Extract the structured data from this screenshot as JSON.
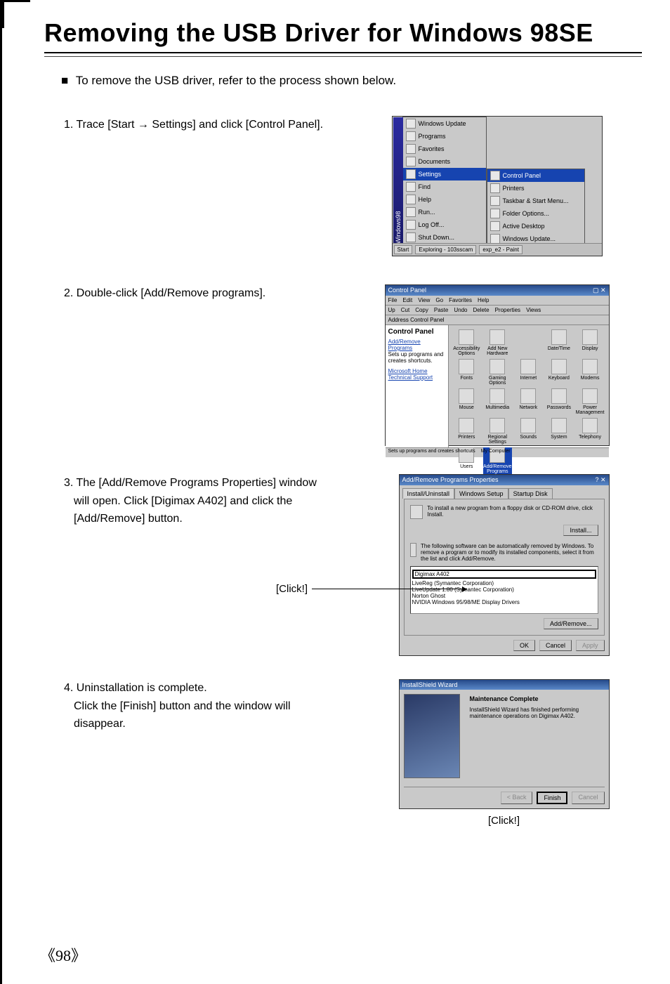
{
  "title": "Removing the USB Driver for Windows 98SE",
  "intro": "To remove the USB driver, refer to the process shown below.",
  "steps": {
    "s1": "1. Trace [Start → Settings] and click [Control Panel].",
    "s2": "2. Double-click [Add/Remove programs].",
    "s3a": "3. The [Add/Remove Programs Properties] window",
    "s3b": "will open. Click [Digimax A402] and click the",
    "s3c": "[Add/Remove] button.",
    "s4a": "4. Uninstallation is complete.",
    "s4b": "Click the [Finish] button and the window will",
    "s4c": "disappear."
  },
  "labels": {
    "click": "[Click!]"
  },
  "shot1": {
    "side_label": "Windows98",
    "menu": [
      "Windows Update",
      "Programs",
      "Favorites",
      "Documents",
      "Settings",
      "Find",
      "Help",
      "Run...",
      "Log Off...",
      "Shut Down..."
    ],
    "submenu": {
      "items": [
        "Control Panel",
        "Printers",
        "Taskbar & Start Menu...",
        "Folder Options...",
        "Active Desktop",
        "Windows Update..."
      ]
    },
    "taskbar": {
      "start": "Start",
      "task1": "Exploring - 103sscam",
      "task2": "exp_e2 - Paint"
    }
  },
  "shot2": {
    "title": "Control Panel",
    "menus": [
      "File",
      "Edit",
      "View",
      "Go",
      "Favorites",
      "Help"
    ],
    "tb": [
      "Up",
      "Cut",
      "Copy",
      "Paste",
      "Undo",
      "Delete",
      "Properties",
      "Views"
    ],
    "addr": "Address  Control Panel",
    "side_title": "Control Panel",
    "side_link1": "Add/Remove Programs",
    "side_desc": "Sets up programs and creates shortcuts.",
    "side_link2": "Microsoft Home",
    "side_link3": "Technical Support",
    "items": [
      "Accessibility Options",
      "Add New Hardware",
      "",
      "Date/Time",
      "Display",
      "Fonts",
      "Gaming Options",
      "Internet",
      "Keyboard",
      "Modems",
      "Mouse",
      "Multimedia",
      "Network",
      "Passwords",
      "Power Management",
      "Printers",
      "Regional Settings",
      "Sounds",
      "System",
      "Telephony",
      "Users",
      "Add/Remove Programs"
    ],
    "status1": "Sets up programs and creates shortcuts",
    "status2": "My Computer"
  },
  "shot3": {
    "title": "Add/Remove Programs Properties",
    "tabs": [
      "Install/Uninstall",
      "Windows Setup",
      "Startup Disk"
    ],
    "top_text": "To install a new program from a floppy disk or CD-ROM drive, click Install.",
    "install_btn": "Install...",
    "mid_text": "The following software can be automatically removed by Windows. To remove a program or to modify its installed components, select it from the list and click Add/Remove.",
    "list": [
      "Digimax A402",
      "LiveReg (Symantec Corporation)",
      "LiveUpdate 1.80 (Symantec Corporation)",
      "Norton Ghost",
      "NVIDIA Windows 95/98/ME Display Drivers"
    ],
    "addremove_btn": "Add/Remove...",
    "ok": "OK",
    "cancel": "Cancel",
    "apply": "Apply"
  },
  "shot4": {
    "title": "InstallShield Wizard",
    "heading": "Maintenance Complete",
    "body": "InstallShield Wizard has finished performing maintenance operations on Digimax A402.",
    "back": "< Back",
    "finish": "Finish",
    "cancel": "Cancel"
  },
  "page_number": "《98》"
}
